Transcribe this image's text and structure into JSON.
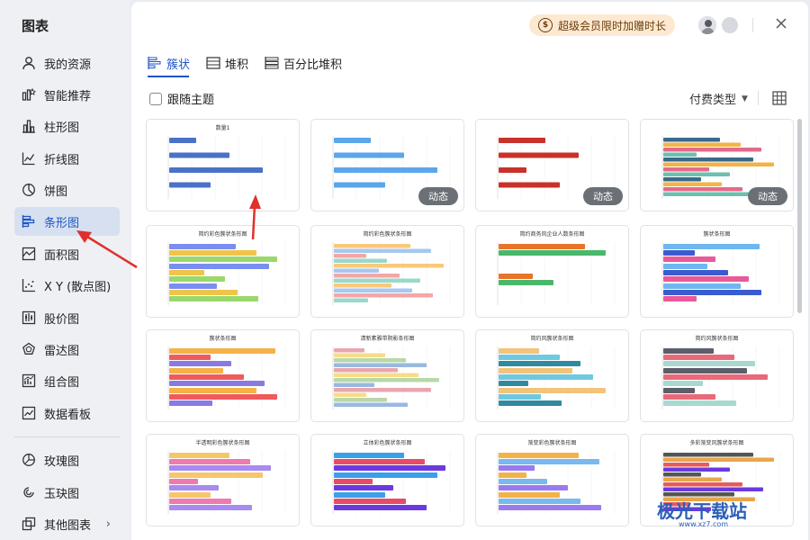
{
  "sidebar": {
    "title": "图表",
    "items": [
      {
        "label": "我的资源",
        "icon": "user-icon"
      },
      {
        "label": "智能推荐",
        "icon": "smart-recommend-icon"
      },
      {
        "label": "柱形图",
        "icon": "column-chart-icon"
      },
      {
        "label": "折线图",
        "icon": "line-chart-icon"
      },
      {
        "label": "饼图",
        "icon": "pie-chart-icon"
      },
      {
        "label": "条形图",
        "icon": "bar-chart-icon",
        "active": true
      },
      {
        "label": "面积图",
        "icon": "area-chart-icon"
      },
      {
        "label": "X Y (散点图)",
        "icon": "scatter-chart-icon"
      },
      {
        "label": "股价图",
        "icon": "stock-chart-icon"
      },
      {
        "label": "雷达图",
        "icon": "radar-chart-icon"
      },
      {
        "label": "组合图",
        "icon": "combo-chart-icon"
      },
      {
        "label": "数据看板",
        "icon": "dashboard-icon"
      }
    ],
    "bottom_items": [
      {
        "label": "玫瑰图",
        "icon": "rose-chart-icon"
      },
      {
        "label": "玉玦图",
        "icon": "ring-chart-icon"
      },
      {
        "label": "其他图表",
        "icon": "other-chart-icon",
        "chevron": "›"
      }
    ]
  },
  "header": {
    "promo_coin": "$",
    "promo_text": "超级会员限时加赠时长"
  },
  "tabs": [
    {
      "label": "簇状",
      "active": true
    },
    {
      "label": "堆积"
    },
    {
      "label": "百分比堆积"
    }
  ],
  "toolbar": {
    "follow_theme": "跟随主题",
    "pay_type": "付费类型"
  },
  "cards": [
    {
      "title": "数量1",
      "dynamic": false
    },
    {
      "title": "",
      "dynamic": true
    },
    {
      "title": "",
      "dynamic": true
    },
    {
      "title": "",
      "dynamic": true
    },
    {
      "title": "简约彩色簇状条形图",
      "dynamic": false
    },
    {
      "title": "简约彩色簇状条形图",
      "dynamic": false
    },
    {
      "title": "简约商务风企业人数条形图",
      "dynamic": false
    },
    {
      "title": "簇状条形图",
      "dynamic": false
    },
    {
      "title": "簇状条形图",
      "dynamic": false
    },
    {
      "title": "清新素雅带阴影条形图",
      "dynamic": false
    },
    {
      "title": "简约风簇状条形图",
      "dynamic": false
    },
    {
      "title": "简约风簇状条形图",
      "dynamic": false
    },
    {
      "title": "半透明彩色簇状条形图",
      "dynamic": false
    },
    {
      "title": "立体彩色簇状条形图",
      "dynamic": false
    },
    {
      "title": "渐变彩色簇状条形图",
      "dynamic": false
    },
    {
      "title": "多彩渐变风簇状条形图",
      "dynamic": false
    }
  ],
  "dynamic_label": "动态",
  "watermark": {
    "text": "极光下载站",
    "sub": "www.xz7.com"
  }
}
